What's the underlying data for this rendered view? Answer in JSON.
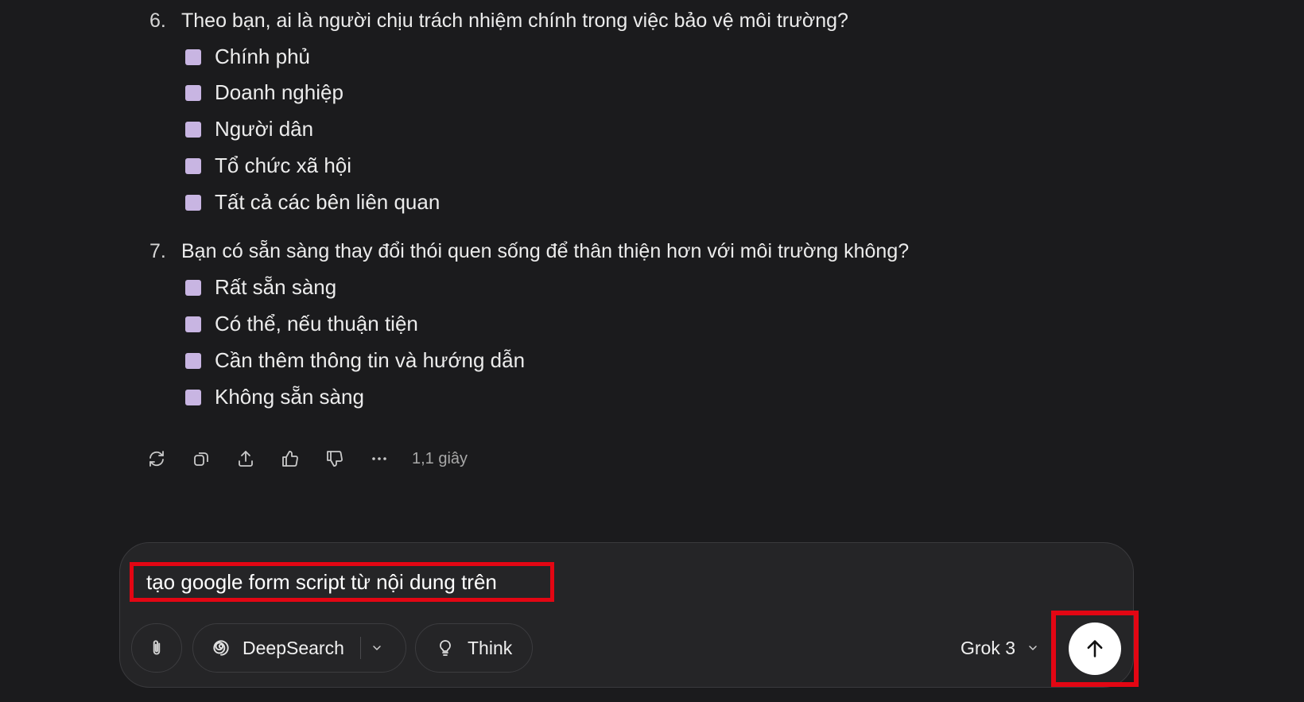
{
  "conversation": {
    "questions": [
      {
        "number": "6.",
        "text": "Theo bạn, ai là người chịu trách nhiệm chính trong việc bảo vệ môi trường?",
        "options": [
          "Chính phủ",
          "Doanh nghiệp",
          "Người dân",
          "Tổ chức xã hội",
          "Tất cả các bên liên quan"
        ]
      },
      {
        "number": "7.",
        "text": "Bạn có sẵn sàng thay đổi thói quen sống để thân thiện hơn với môi trường không?",
        "options": [
          "Rất sẵn sàng",
          "Có thể, nếu thuận tiện",
          "Cần thêm thông tin và hướng dẫn",
          "Không sẵn sàng"
        ]
      }
    ],
    "actions": {
      "icons": [
        "regenerate-icon",
        "copy-icon",
        "share-icon",
        "thumbs-up-icon",
        "thumbs-down-icon",
        "more-icon"
      ],
      "response_time": "1,1 giây"
    }
  },
  "composer": {
    "input_value": "tạo google form script từ nội dung trên",
    "deepsearch_label": "DeepSearch",
    "think_label": "Think",
    "model_label": "Grok 3"
  },
  "colors": {
    "background": "#1b1b1d",
    "composer_bg": "#252527",
    "checkbox": "#c8b5e2",
    "highlight": "#e30613"
  }
}
